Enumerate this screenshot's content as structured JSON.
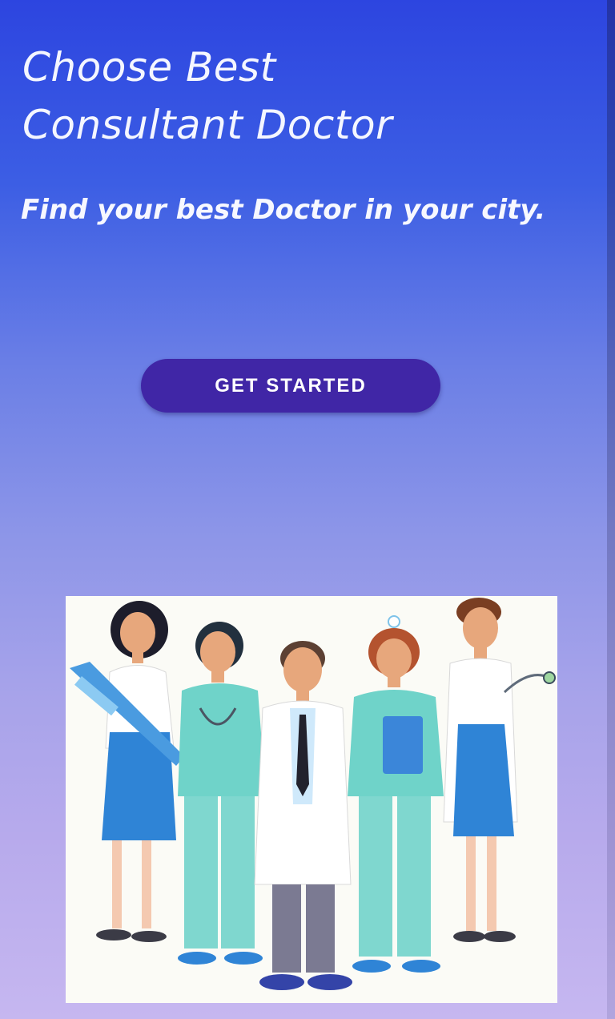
{
  "hero": {
    "title_line1": "Choose Best",
    "title_line2": "Consultant Doctor",
    "subtitle": "Find your best Doctor in your city."
  },
  "cta": {
    "label": "GET STARTED"
  },
  "colors": {
    "gradient_top": "#2d45e0",
    "gradient_bottom": "#c6b7f0",
    "button": "#4026a6",
    "scrubs": "#6fd3c9",
    "blue_dress": "#2f84d6"
  },
  "illustration": {
    "icon": "medical-team-illustration"
  }
}
